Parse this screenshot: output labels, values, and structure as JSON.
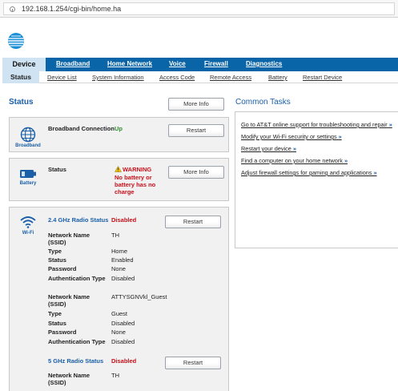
{
  "browser": {
    "url": "192.168.1.254/cgi-bin/home.ha"
  },
  "colors": {
    "nav_bg": "#0a64a8",
    "active_tab": "#cfe3f3",
    "accent_blue": "#1a5fa8",
    "alert_red": "#c8101a",
    "ok_green": "#2d8f2d"
  },
  "nav": {
    "main": [
      "Device",
      "Broadband",
      "Home Network",
      "Voice",
      "Firewall",
      "Diagnostics"
    ],
    "sub": [
      "Status",
      "Device List",
      "System Information",
      "Access Code",
      "Remote Access",
      "Battery",
      "Restart Device"
    ]
  },
  "status": {
    "heading": "Status",
    "more_info": "More Info",
    "broadband": {
      "icon_label": "Broadband",
      "label": "Broadband Connection",
      "value": "Up",
      "button": "Restart"
    },
    "battery": {
      "icon_label": "Battery",
      "label": "Status",
      "warning": "WARNING",
      "message": "No battery or battery has no charge",
      "button": "More Info"
    },
    "wifi": {
      "icon_label": "Wi-Fi",
      "radio24": {
        "label": "2.4 GHz Radio Status",
        "value": "Disabled",
        "button": "Restart"
      },
      "net1": [
        {
          "label": "Network Name (SSID)",
          "value": "TH"
        },
        {
          "label": "Type",
          "value": "Home"
        },
        {
          "label": "Status",
          "value": "Enabled"
        },
        {
          "label": "Password",
          "value": "None"
        },
        {
          "label": "Authentication Type",
          "value": "Disabled"
        }
      ],
      "net2": [
        {
          "label": "Network Name (SSID)",
          "value": "ATTYSGNVkl_Guest"
        },
        {
          "label": "Type",
          "value": "Guest"
        },
        {
          "label": "Status",
          "value": "Disabled"
        },
        {
          "label": "Password",
          "value": "None"
        },
        {
          "label": "Authentication Type",
          "value": "Disabled"
        }
      ],
      "radio5": {
        "label": "5 GHz Radio Status",
        "value": "Disabled",
        "button": "Restart"
      },
      "net3": [
        {
          "label": "Network Name (SSID)",
          "value": "TH"
        }
      ]
    }
  },
  "common_tasks": {
    "heading": "Common Tasks",
    "items": [
      "Go to AT&T online support for troubleshooting and repair",
      "Modify your Wi-Fi security or settings",
      "Restart your device",
      "Find a computer on your home network",
      "Adjust firewall settings for gaming and applications"
    ],
    "chevron": "»"
  }
}
